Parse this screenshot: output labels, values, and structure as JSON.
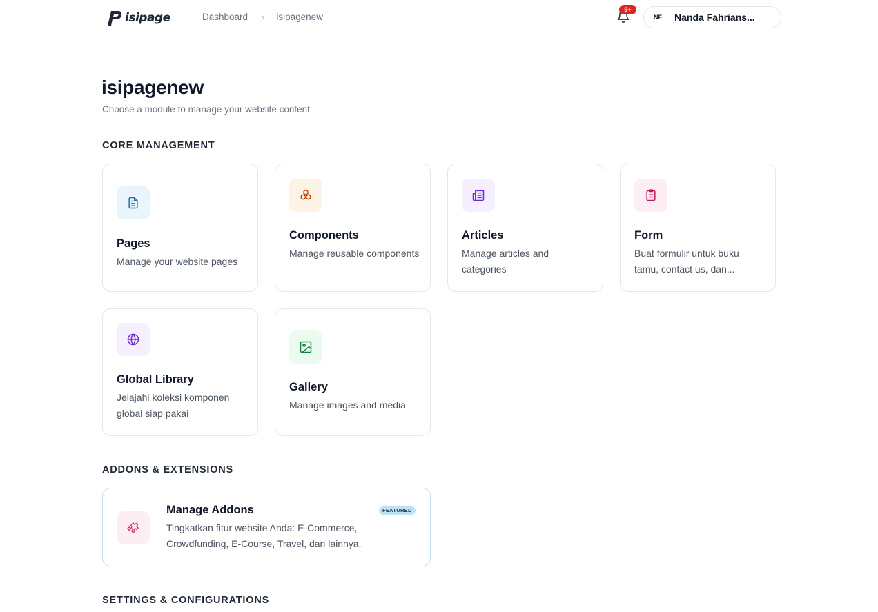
{
  "header": {
    "logo_text": "isipage",
    "breadcrumb": {
      "home": "Dashboard",
      "separator": "›",
      "current": "isipagenew"
    },
    "notifications": {
      "badge": "9+"
    },
    "user": {
      "initials": "NF",
      "name": "Nanda Fahrians..."
    }
  },
  "page": {
    "title": "isipagenew",
    "subtitle": "Choose a module to manage your website content"
  },
  "sections": {
    "core": "CORE MANAGEMENT",
    "addons": "ADDONS & EXTENSIONS",
    "settings": "SETTINGS & CONFIGURATIONS"
  },
  "modules": [
    {
      "title": "Pages",
      "desc": "Manage your website pages",
      "icon": "file-icon",
      "color": "#1e6fa8",
      "bg": "#e8f5fc"
    },
    {
      "title": "Components",
      "desc": "Manage reusable components",
      "icon": "cubes-icon",
      "color": "#c2410c",
      "bg": "#fdf4e7"
    },
    {
      "title": "Articles",
      "desc": "Manage articles and categories",
      "icon": "newspaper-icon",
      "color": "#6d28d9",
      "bg": "#f5efff"
    },
    {
      "title": "Form",
      "desc": "Buat formulir untuk buku tamu, contact us, dan...",
      "icon": "clipboard-icon",
      "color": "#be185d",
      "bg": "#fdeef3"
    },
    {
      "title": "Global Library",
      "desc": "Jelajahi koleksi komponen global siap pakai",
      "icon": "globe-icon",
      "color": "#6d28d9",
      "bg": "#f5efff"
    },
    {
      "title": "Gallery",
      "desc": "Manage images and media",
      "icon": "image-icon",
      "color": "#15803d",
      "bg": "#ecfbf0"
    }
  ],
  "addon": {
    "title": "Manage Addons",
    "desc": "Tingkatkan fitur website Anda: E-Commerce, Crowdfunding, E-Course, Travel, dan lainnya.",
    "badge": "FEATURED",
    "icon": "puzzle-icon",
    "color": "#db2777",
    "bg": "#fdeef3"
  }
}
